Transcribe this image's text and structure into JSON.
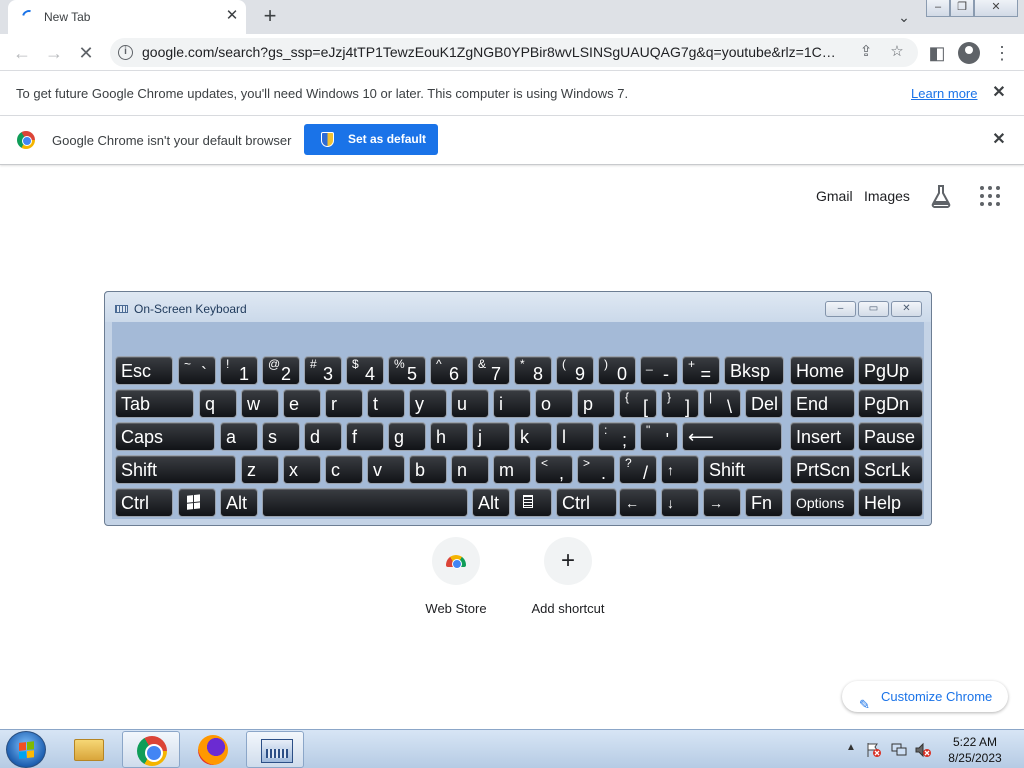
{
  "browser": {
    "tab_title": "New Tab",
    "url": "google.com/search?gs_ssp=eJzj4tTP1TewzEouK1ZgNGB0YPBir8wvLSINSgUAUQAG7g&q=youtube&rlz=1C1GCE...",
    "window_buttons": [
      "minimize",
      "restore",
      "close"
    ]
  },
  "infobar": {
    "message": "To get future Google Chrome updates, you'll need Windows 10 or later. This computer is using Windows 7.",
    "link": "Learn more"
  },
  "default_bar": {
    "message": "Google Chrome isn't your default browser",
    "button": "Set as default"
  },
  "page": {
    "links": {
      "gmail": "Gmail",
      "images": "Images"
    },
    "shortcuts": [
      {
        "label": "Web Store",
        "icon": "web-store-icon"
      },
      {
        "label": "Add shortcut",
        "icon": "plus-icon"
      }
    ],
    "customize": "Customize Chrome"
  },
  "osk": {
    "title": "On-Screen Keyboard",
    "rows": [
      [
        {
          "main": "Esc"
        },
        {
          "shift": "~",
          "low": "`"
        },
        {
          "shift": "!",
          "low": "1"
        },
        {
          "shift": "@",
          "low": "2"
        },
        {
          "shift": "#",
          "low": "3"
        },
        {
          "shift": "$",
          "low": "4"
        },
        {
          "shift": "%",
          "low": "5"
        },
        {
          "shift": "^",
          "low": "6"
        },
        {
          "shift": "&",
          "low": "7"
        },
        {
          "shift": "*",
          "low": "8"
        },
        {
          "shift": "(",
          "low": "9"
        },
        {
          "shift": ")",
          "low": "0"
        },
        {
          "shift": "_",
          "low": "-"
        },
        {
          "shift": "+",
          "low": "="
        },
        {
          "main": "Bksp"
        },
        {
          "main": "Home"
        },
        {
          "main": "PgUp"
        }
      ],
      [
        {
          "main": "Tab"
        },
        {
          "main": "q"
        },
        {
          "main": "w"
        },
        {
          "main": "e"
        },
        {
          "main": "r"
        },
        {
          "main": "t"
        },
        {
          "main": "y"
        },
        {
          "main": "u"
        },
        {
          "main": "i"
        },
        {
          "main": "o"
        },
        {
          "main": "p"
        },
        {
          "shift": "{",
          "low": "["
        },
        {
          "shift": "}",
          "low": "]"
        },
        {
          "shift": "|",
          "low": "\\"
        },
        {
          "main": "Del"
        },
        {
          "main": "End"
        },
        {
          "main": "PgDn"
        }
      ],
      [
        {
          "main": "Caps"
        },
        {
          "main": "a"
        },
        {
          "main": "s"
        },
        {
          "main": "d"
        },
        {
          "main": "f"
        },
        {
          "main": "g"
        },
        {
          "main": "h"
        },
        {
          "main": "j"
        },
        {
          "main": "k"
        },
        {
          "main": "l"
        },
        {
          "shift": ":",
          "low": ";"
        },
        {
          "shift": "\"",
          "low": "'"
        },
        {
          "main": "⟵"
        },
        {
          "main": "Insert"
        },
        {
          "main": "Pause"
        }
      ],
      [
        {
          "main": "Shift"
        },
        {
          "main": "z"
        },
        {
          "main": "x"
        },
        {
          "main": "c"
        },
        {
          "main": "v"
        },
        {
          "main": "b"
        },
        {
          "main": "n"
        },
        {
          "main": "m"
        },
        {
          "shift": "<",
          "low": ","
        },
        {
          "shift": ">",
          "low": "."
        },
        {
          "shift": "?",
          "low": "/"
        },
        {
          "small": "↑"
        },
        {
          "main": "Shift"
        },
        {
          "main": "PrtScn"
        },
        {
          "main": "ScrLk"
        }
      ],
      [
        {
          "main": "Ctrl"
        },
        {
          "icon": "windows-logo-icon"
        },
        {
          "main": "Alt"
        },
        {
          "main": ""
        },
        {
          "main": "Alt"
        },
        {
          "icon": "menu-key-icon"
        },
        {
          "main": "Ctrl"
        },
        {
          "small": "←"
        },
        {
          "small": "↓"
        },
        {
          "small": "→"
        },
        {
          "main": "Fn"
        },
        {
          "small": "Options"
        },
        {
          "main": "Help"
        }
      ]
    ]
  },
  "taskbar": {
    "apps": [
      {
        "name": "windows-explorer",
        "icon": "folder-icon"
      },
      {
        "name": "google-chrome",
        "icon": "chrome-icon"
      },
      {
        "name": "firefox",
        "icon": "firefox-icon"
      },
      {
        "name": "on-screen-keyboard",
        "icon": "keyboard-icon"
      }
    ],
    "time": "5:22 AM",
    "date": "8/25/2023"
  },
  "colors": {
    "accent": "#1a73e8",
    "osk_background": "#a4bad7",
    "key_face": "#1b1d21"
  }
}
